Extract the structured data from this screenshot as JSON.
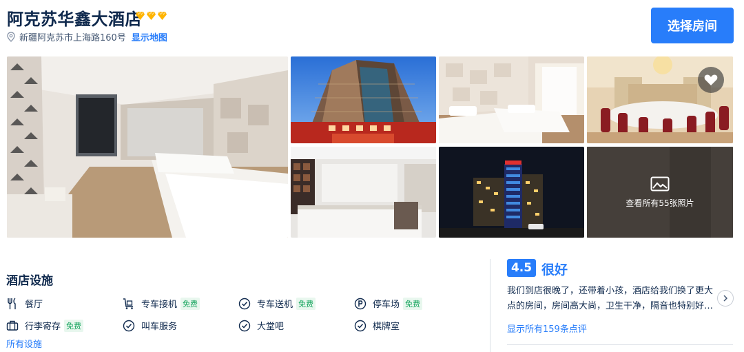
{
  "hotel": {
    "name": "阿克苏华鑫大酒店",
    "diamond_count": 3,
    "address": "新疆阿克苏市上海路160号",
    "map_link": "显示地图",
    "select_button": "选择房间"
  },
  "gallery": {
    "photos": [
      {
        "name": "photo-room-main",
        "icon": "hotel-room-photo"
      },
      {
        "name": "photo-building-exterior",
        "icon": "building-photo"
      },
      {
        "name": "photo-twin-room",
        "icon": "hotel-room-photo"
      },
      {
        "name": "photo-banquet-hall",
        "icon": "dining-hall-photo"
      },
      {
        "name": "photo-lobby-reception",
        "icon": "reception-photo"
      },
      {
        "name": "photo-night-exterior",
        "icon": "night-building-photo"
      },
      {
        "name": "photo-more",
        "icon": "image-icon"
      }
    ],
    "view_all_label": "查看所有55张照片"
  },
  "facilities": {
    "title": "酒店设施",
    "items": [
      {
        "label": "餐厅",
        "icon": "fork-knife-icon",
        "free": ""
      },
      {
        "label": "专车接机",
        "icon": "luggage-cart-icon",
        "free": "免费"
      },
      {
        "label": "专车送机",
        "icon": "check-circle-icon",
        "free": "免费"
      },
      {
        "label": "停车场",
        "icon": "parking-icon",
        "free": "免费"
      },
      {
        "label": "行李寄存",
        "icon": "luggage-icon",
        "free": "免费"
      },
      {
        "label": "叫车服务",
        "icon": "check-circle-icon",
        "free": ""
      },
      {
        "label": "大堂吧",
        "icon": "check-circle-icon",
        "free": ""
      },
      {
        "label": "棋牌室",
        "icon": "check-circle-icon",
        "free": ""
      }
    ],
    "all_link": "所有设施"
  },
  "reviews": {
    "score": "4.5",
    "score_label": "很好",
    "excerpt": "我们到店很晚了，还带着小孩，酒店给我们换了更大点的房间，房间高大尚，卫生干净，隔音也特别好…",
    "all_link": "显示所有159条点评"
  },
  "colors": {
    "accent": "#287dfa",
    "diamond": "#ffb400",
    "free_badge_text": "#11a35a",
    "free_badge_bg": "#e8f7ee"
  }
}
